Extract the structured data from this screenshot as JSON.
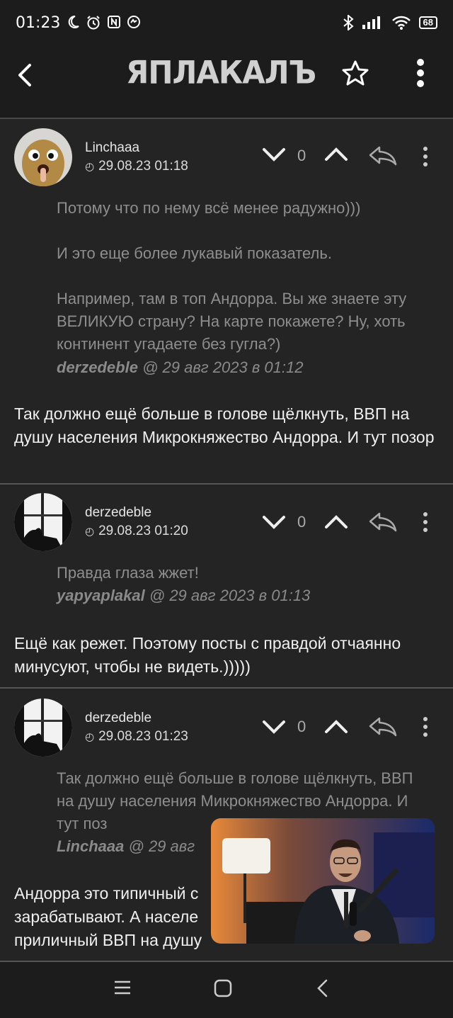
{
  "status_bar": {
    "time": "01:23",
    "battery": "68"
  },
  "app": {
    "logo_text": "ЯПЛАКАЛЪ"
  },
  "comments": [
    {
      "author": "Linchaaa",
      "date": "29.08.23 01:18",
      "votes": "0",
      "quote_text": "Потому что по нему всё менее радужно)))\n\nИ это еще более лукавый показатель.\n\nНапример, там в топ Андорра. Вы же знаете эту ВЕЛИКУЮ страну? На карте покажете? Ну, хоть континент угадаете без гугла?)",
      "quote_author": "derzedeble",
      "quote_date": "@ 29 авг 2023 в 01:12",
      "text": "Так должно ещё больше в голове щёлкнуть, ВВП на душу населения Микрокняжество Андорра. И тут позор"
    },
    {
      "author": "derzedeble",
      "date": "29.08.23 01:20",
      "votes": "0",
      "quote_text": "Правда глаза жжет!",
      "quote_author": "yapyaplakal",
      "quote_date": "@ 29 авг 2023 в 01:13",
      "text": "Ещё как режет. Поэтому посты с правдой отчаянно минусуют, чтобы не видеть.)))))"
    },
    {
      "author": "derzedeble",
      "date": "29.08.23 01:23",
      "votes": "0",
      "quote_text": "Так должно ещё больше в голове щёлкнуть, ВВП на душу населения Микрокняжество Андорра. И тут поз",
      "quote_author": "Linchaaa",
      "quote_date": "@ 29 авг",
      "text": "Андорра это типичный с\nзарабатывают. А населе\nприличный ВВП на душу"
    }
  ]
}
